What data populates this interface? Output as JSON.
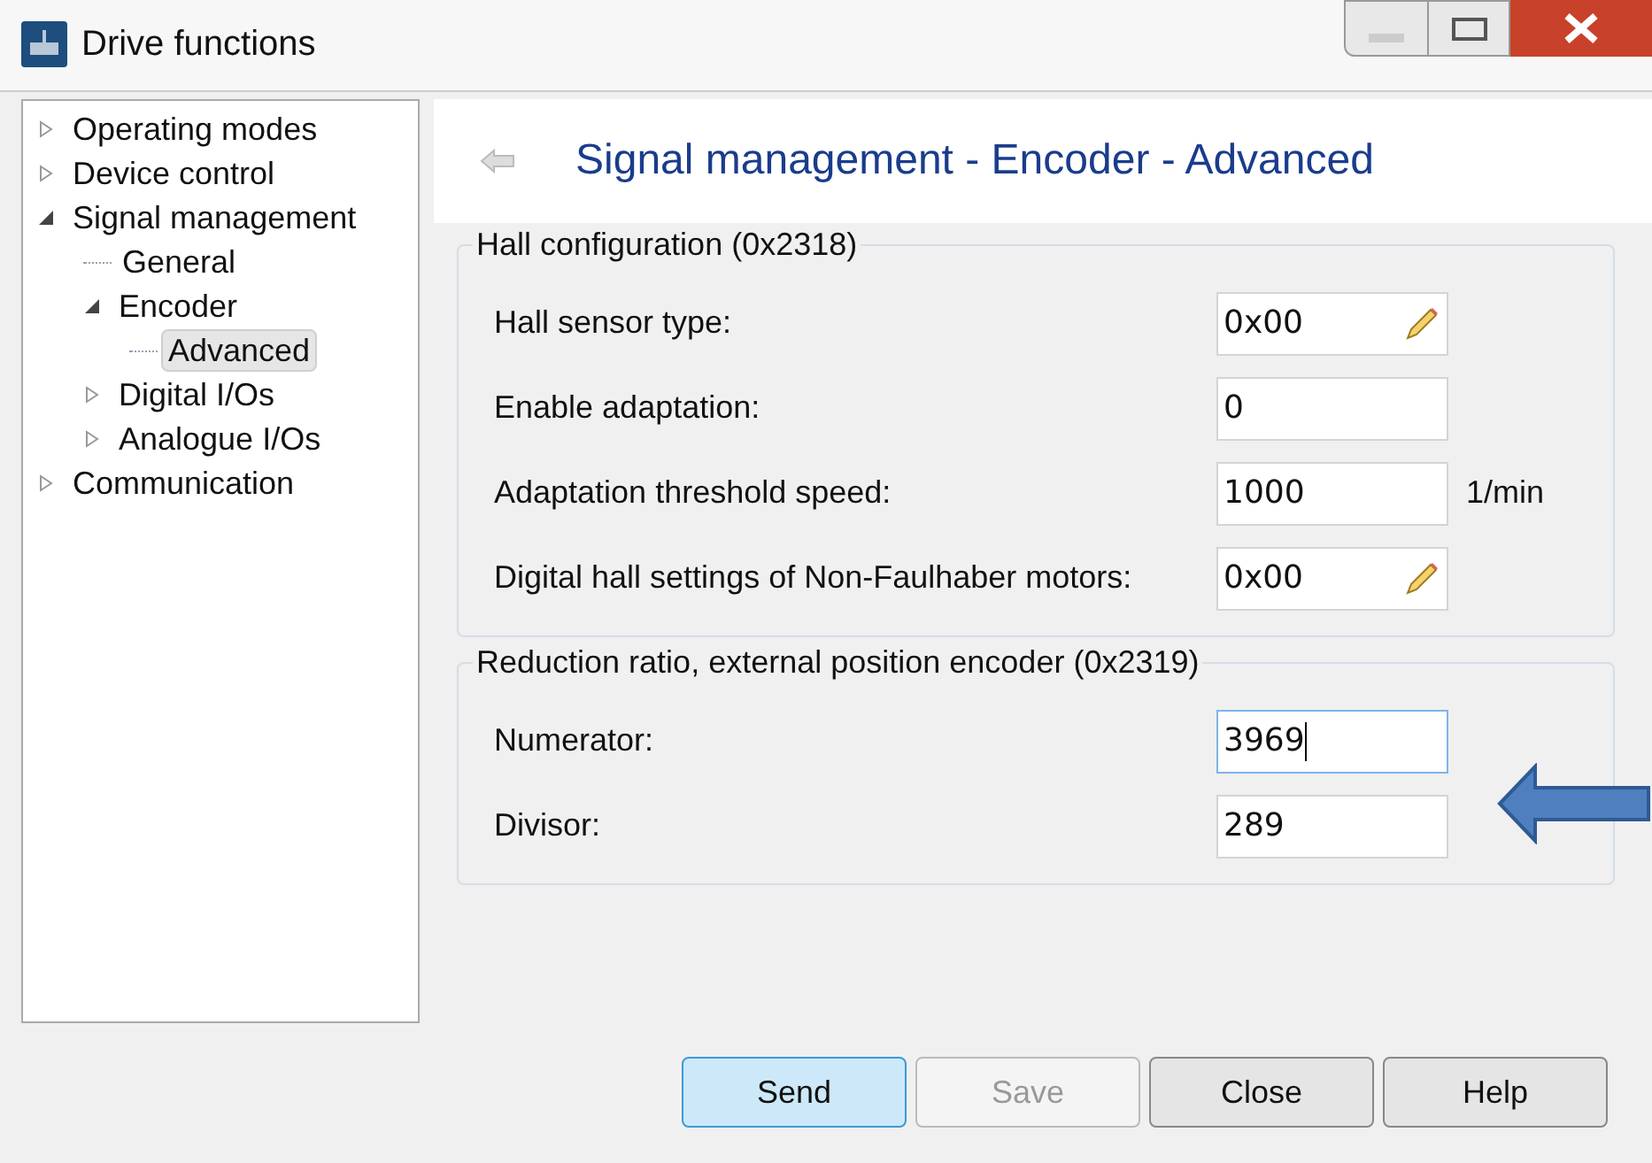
{
  "window": {
    "title": "Drive functions"
  },
  "tree": [
    {
      "label": "Operating modes",
      "kind": "branch",
      "expanded": false,
      "selected": false
    },
    {
      "label": "Device control",
      "kind": "branch",
      "expanded": false,
      "selected": false
    },
    {
      "label": "Signal management",
      "kind": "branch",
      "expanded": true,
      "selected": false,
      "children": [
        {
          "label": "General",
          "kind": "leaf",
          "selected": false
        },
        {
          "label": "Encoder",
          "kind": "branch",
          "expanded": true,
          "selected": false,
          "children": [
            {
              "label": "Advanced",
              "kind": "leaf",
              "selected": true
            }
          ]
        },
        {
          "label": "Digital I/Os",
          "kind": "branch",
          "expanded": false,
          "selected": false
        },
        {
          "label": "Analogue I/Os",
          "kind": "branch",
          "expanded": false,
          "selected": false
        }
      ]
    },
    {
      "label": "Communication",
      "kind": "branch",
      "expanded": false,
      "selected": false
    }
  ],
  "page_title": "Signal management - Encoder - Advanced",
  "groups": [
    {
      "title": "Hall configuration (0x2318)",
      "fields": [
        {
          "label": "Hall sensor type:",
          "value": "0x00",
          "kind": "pencil",
          "focused": false
        },
        {
          "label": "Enable adaptation:",
          "value": "0",
          "kind": "plain",
          "focused": false
        },
        {
          "label": "Adaptation threshold speed:",
          "value": "1000",
          "kind": "plain",
          "unit": "1/min",
          "focused": false
        },
        {
          "label": "Digital hall settings of Non-Faulhaber motors:",
          "value": "0x00",
          "kind": "pencil",
          "focused": false
        }
      ]
    },
    {
      "title": "Reduction ratio, external position encoder (0x2319)",
      "fields": [
        {
          "label": "Numerator:",
          "value": "3969",
          "kind": "plain",
          "focused": true
        },
        {
          "label": "Divisor:",
          "value": "289",
          "kind": "plain",
          "focused": false
        }
      ]
    }
  ],
  "buttons": [
    {
      "label": "Send",
      "default": true,
      "disabled": false
    },
    {
      "label": "Save",
      "default": false,
      "disabled": true
    },
    {
      "label": "Close",
      "default": false,
      "disabled": false
    },
    {
      "label": "Help",
      "default": false,
      "disabled": false
    }
  ]
}
